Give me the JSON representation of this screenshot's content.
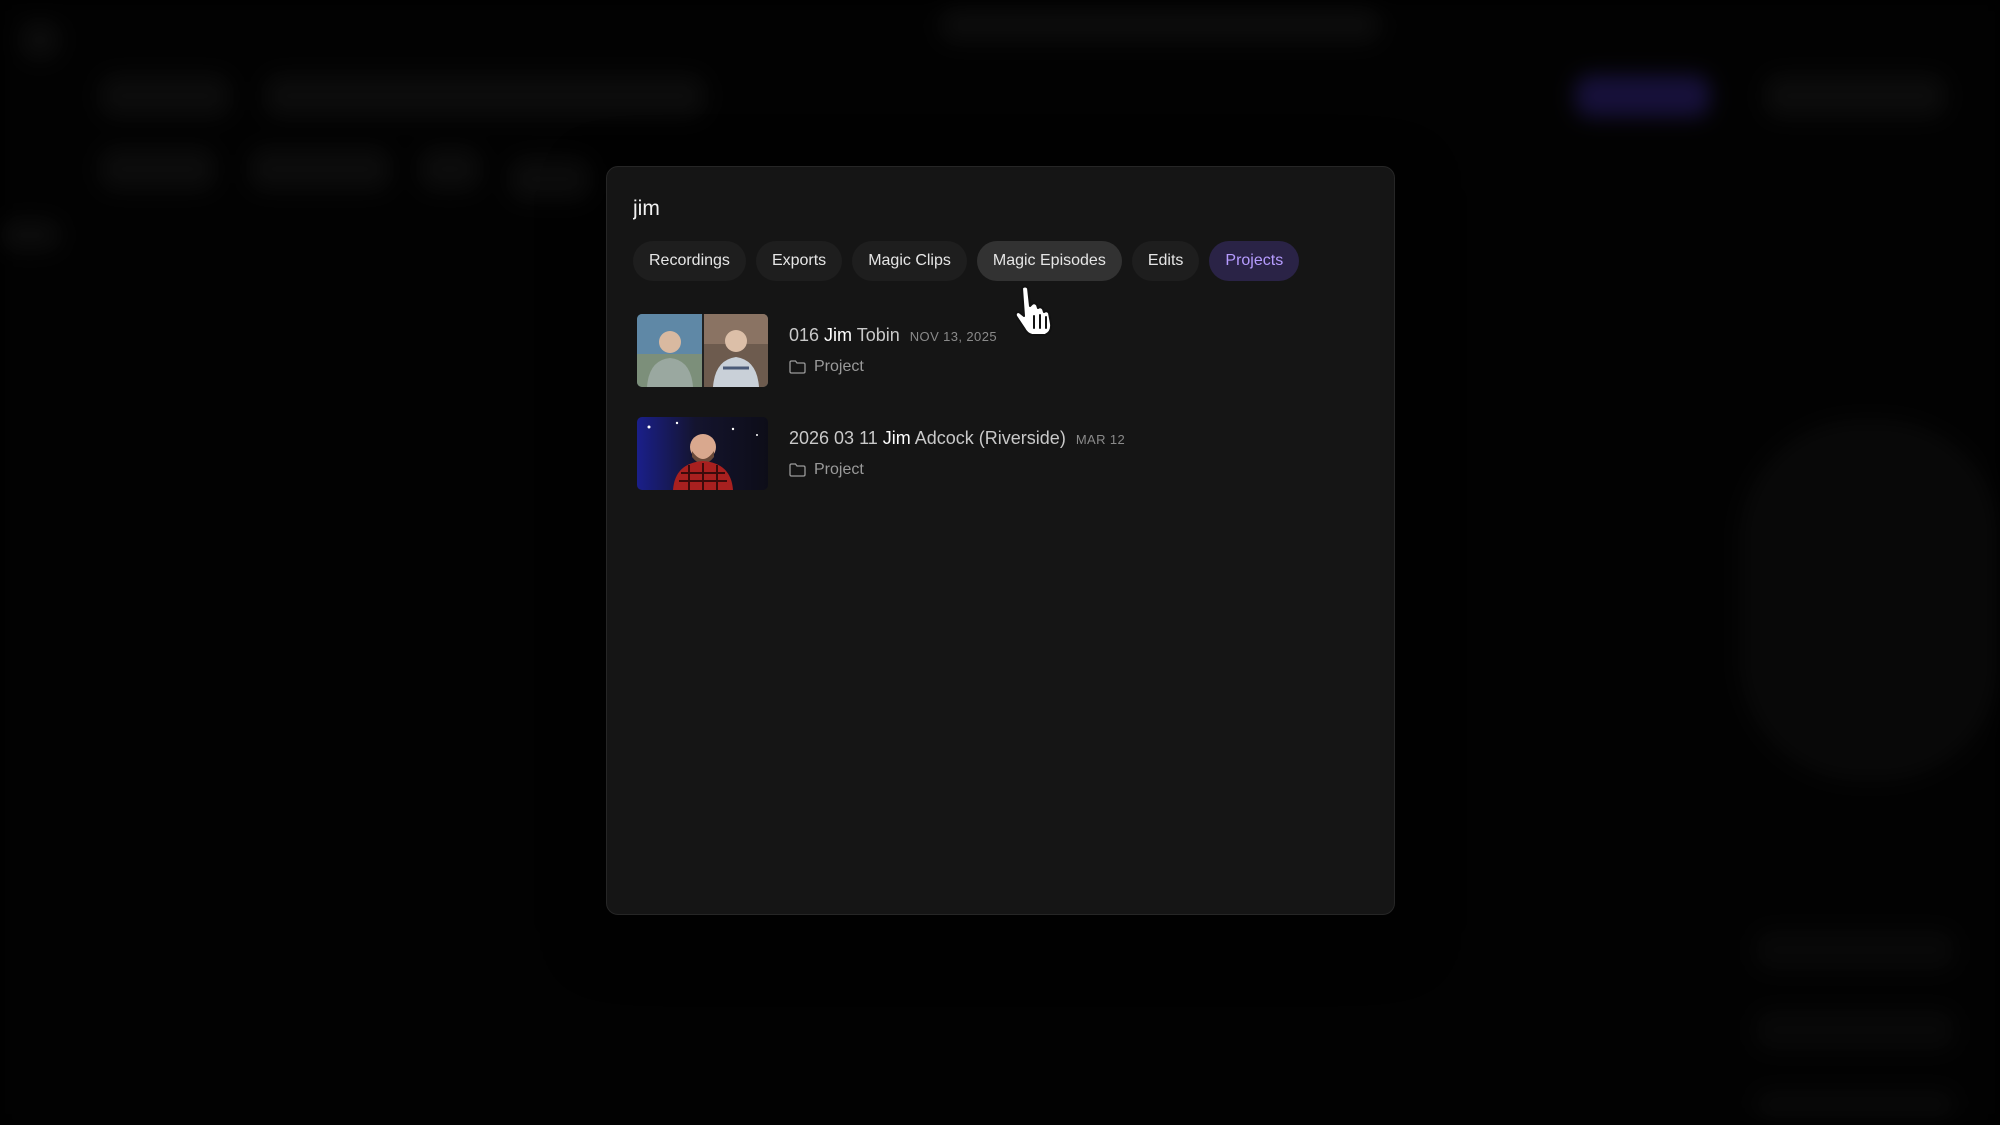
{
  "search": {
    "query": "jim"
  },
  "tabs": [
    {
      "label": "Recordings"
    },
    {
      "label": "Exports"
    },
    {
      "label": "Magic Clips"
    },
    {
      "label": "Magic Episodes",
      "state": "hover"
    },
    {
      "label": "Edits"
    },
    {
      "label": "Projects",
      "state": "active"
    }
  ],
  "results": [
    {
      "title_pre": "016 ",
      "title_match": "Jim",
      "title_post": " Tobin",
      "date": "NOV 13, 2025",
      "type_icon": "folder-icon",
      "type_label": "Project"
    },
    {
      "title_pre": "2026 03 11 ",
      "title_match": "Jim",
      "title_post": " Adcock (Riverside)",
      "date": "MAR 12",
      "type_icon": "folder-icon",
      "type_label": "Project"
    }
  ],
  "colors": {
    "accent": "#b69cff",
    "active_tab_bg": "#2a2346",
    "modal_bg": "#151515"
  }
}
